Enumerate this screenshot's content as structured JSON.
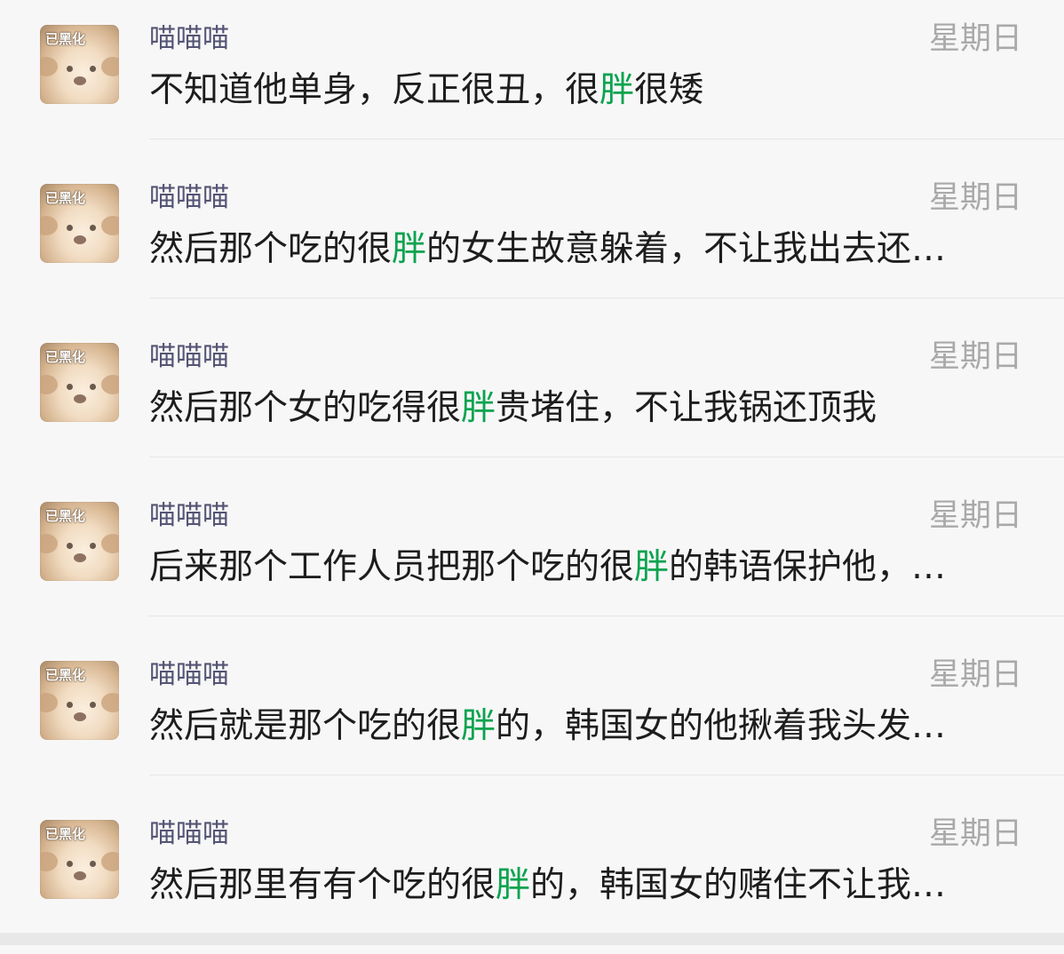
{
  "conversations": [
    {
      "name": "喵喵喵",
      "time": "星期日",
      "avatar_tag": "已黑化",
      "msg_before": "不知道他单身，反正很丑，很",
      "msg_highlight": "胖",
      "msg_after": "很矮"
    },
    {
      "name": "喵喵喵",
      "time": "星期日",
      "avatar_tag": "已黑化",
      "msg_before": "然后那个吃的很",
      "msg_highlight": "胖",
      "msg_after": "的女生故意躲着，不让我出去还…"
    },
    {
      "name": "喵喵喵",
      "time": "星期日",
      "avatar_tag": "已黑化",
      "msg_before": "然后那个女的吃得很",
      "msg_highlight": "胖",
      "msg_after": "贵堵住，不让我锅还顶我"
    },
    {
      "name": "喵喵喵",
      "time": "星期日",
      "avatar_tag": "已黑化",
      "msg_before": "后来那个工作人员把那个吃的很",
      "msg_highlight": "胖",
      "msg_after": "的韩语保护他，…"
    },
    {
      "name": "喵喵喵",
      "time": "星期日",
      "avatar_tag": "已黑化",
      "msg_before": "然后就是那个吃的很",
      "msg_highlight": "胖",
      "msg_after": "的，韩国女的他揪着我头发…"
    },
    {
      "name": "喵喵喵",
      "time": "星期日",
      "avatar_tag": "已黑化",
      "msg_before": "然后那里有有个吃的很",
      "msg_highlight": "胖",
      "msg_after": "的，韩国女的赌住不让我…"
    }
  ],
  "colors": {
    "background": "#f7f7f7",
    "name": "#545475",
    "time": "#a9a9a9",
    "message": "#1d1d1d",
    "highlight": "#0aa34f",
    "divider": "#e6e6e6"
  }
}
